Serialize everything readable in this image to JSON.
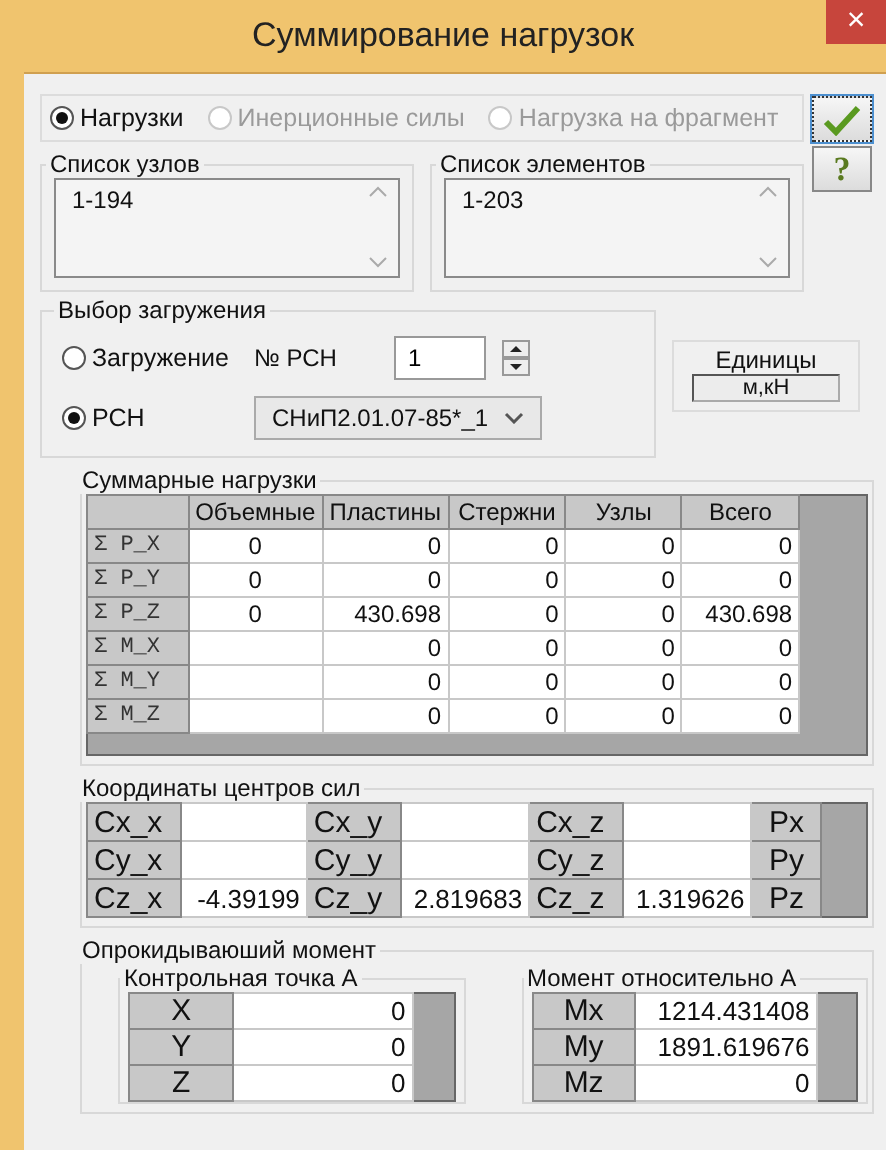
{
  "window": {
    "title": "Суммирование нагрузок",
    "close": "×"
  },
  "buttons": [
    {
      "kind": "apply"
    },
    {
      "kind": "help",
      "label": "?"
    }
  ],
  "mode_options": [
    {
      "label": "Нагрузки",
      "selected": true,
      "disabled": false
    },
    {
      "label": "Инерционные силы",
      "selected": false,
      "disabled": true
    },
    {
      "label": "Нагрузка на фрагмент",
      "selected": false,
      "disabled": true
    }
  ],
  "node_list": {
    "label": "Список узлов",
    "value": "1-194"
  },
  "element_list": {
    "label": "Список элементов",
    "value": "1-203"
  },
  "load_choice": {
    "label": "Выбор загружения",
    "options": [
      {
        "label": "Загружение",
        "selected": false
      },
      {
        "label": "РСН",
        "selected": true
      }
    ],
    "rsn_number_label": "№ РСН",
    "rsn_number": "1",
    "combination": "СНиП2.01.07-85*_1"
  },
  "units": {
    "label": "Единицы",
    "value": "м,кН"
  },
  "sum_loads": {
    "label": "Суммарные нагрузки",
    "columns": [
      "Объемные",
      "Пластины",
      "Стержни",
      "Узлы",
      "Всего"
    ],
    "rows": [
      {
        "label": "Σ P_X",
        "cells": [
          "0",
          "0",
          "0",
          "0",
          "0"
        ]
      },
      {
        "label": "Σ P_Y",
        "cells": [
          "0",
          "0",
          "0",
          "0",
          "0"
        ]
      },
      {
        "label": "Σ P_Z",
        "cells": [
          "0",
          "430.698",
          "0",
          "0",
          "430.698"
        ]
      },
      {
        "label": "Σ M_X",
        "cells": [
          null,
          "0",
          "0",
          "0",
          "0"
        ]
      },
      {
        "label": "Σ M_Y",
        "cells": [
          null,
          "0",
          "0",
          "0",
          "0"
        ]
      },
      {
        "label": "Σ M_Z",
        "cells": [
          null,
          "0",
          "0",
          "0",
          "0"
        ]
      }
    ]
  },
  "centers": {
    "label": "Координаты центров сил",
    "rows": [
      {
        "cells": [
          {
            "label": "Cx_x"
          },
          {
            "label": "Cx_y"
          },
          {
            "label": "Cx_z"
          }
        ],
        "end": "Px"
      },
      {
        "cells": [
          {
            "label": "Cy_x"
          },
          {
            "label": "Cy_y"
          },
          {
            "label": "Cy_z"
          }
        ],
        "end": "Py"
      },
      {
        "cells": [
          {
            "label": "Cz_x",
            "value": "-4.39199"
          },
          {
            "label": "Cz_y",
            "value": "2.819683"
          },
          {
            "label": "Cz_z",
            "value": "1.319626"
          }
        ],
        "end": "Pz"
      }
    ]
  },
  "overturning": {
    "label": "Опрокидываюший момент",
    "point": {
      "label": "Контрольная точка А",
      "rows": [
        {
          "label": "X",
          "value": "0"
        },
        {
          "label": "Y",
          "value": "0"
        },
        {
          "label": "Z",
          "value": "0"
        }
      ]
    },
    "moment": {
      "label": "Момент относительно А",
      "rows": [
        {
          "label": "Mx",
          "value": "1214.431408"
        },
        {
          "label": "My",
          "value": "1891.619676"
        },
        {
          "label": "Mz",
          "value": "0"
        }
      ]
    }
  }
}
